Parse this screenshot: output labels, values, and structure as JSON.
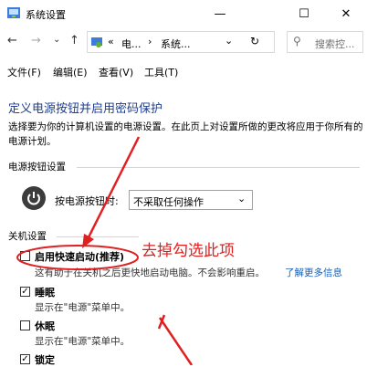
{
  "window": {
    "title": "系统设置",
    "controls": {
      "minimize": "—",
      "maximize": "☐",
      "close": "✕"
    }
  },
  "nav": {
    "back": "←",
    "forward": "→",
    "recent": "⌄",
    "up": "↑",
    "breadcrumb_prefix": "«",
    "crumb1": "电...",
    "crumb_sep": "›",
    "crumb2": "系统...",
    "dropdown": "⌄",
    "refresh": "↻",
    "search_placeholder": "搜索控..."
  },
  "menu": [
    "文件(F)",
    "编辑(E)",
    "查看(V)",
    "工具(T)"
  ],
  "content": {
    "heading": "定义电源按钮并启用密码保护",
    "intro": "选择要为你的计算机设置的电源设置。在此页上对设置所做的更改将应用于你所有的电源计划。",
    "power_section": "电源按钮设置",
    "power_label": "按电源按钮时:",
    "power_value": "不采取任何操作",
    "shutdown_section": "关机设置",
    "options": [
      {
        "label": "启用快速启动(推荐)",
        "checked": false,
        "desc": "这有助于在关机之后更快地启动电脑。不会影响重启。",
        "link": "了解更多信息"
      },
      {
        "label": "睡眠",
        "checked": true,
        "desc": "显示在\"电源\"菜单中。"
      },
      {
        "label": "休眠",
        "checked": false,
        "desc": "显示在\"电源\"菜单中。"
      },
      {
        "label": "锁定",
        "checked": true
      }
    ],
    "check_mark": "✓",
    "annotation": "去掉勾选此项"
  },
  "colors": {
    "heading": "#1e3f90",
    "annotation": "#e02020",
    "link": "#1a5fb4"
  }
}
